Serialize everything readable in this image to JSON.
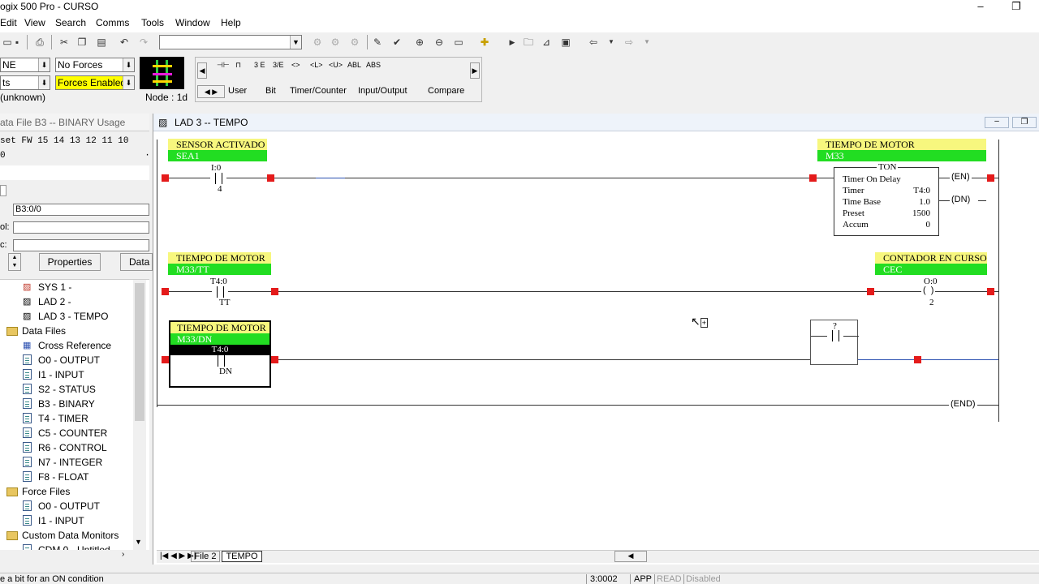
{
  "app": {
    "title": "ogix 500 Pro - CURSO"
  },
  "menu": [
    "Edit",
    "View",
    "Search",
    "Comms",
    "Tools",
    "Window",
    "Help"
  ],
  "toolbar": {
    "combo_value": ""
  },
  "status_panel": {
    "mode_value": "NE",
    "forces_value": "No Forces",
    "edits_value": "ts",
    "forces_enabled": "Forces Enabled",
    "unknown": "(unknown)",
    "node": "Node :  1d"
  },
  "instr_toolbar": {
    "icons": [
      "rung-icon",
      "branch-icon",
      "xic-icon",
      "xio-icon",
      "ote-icon",
      "otl-icon",
      "otu-icon",
      "abl-icon",
      "abs-icon"
    ],
    "icon_text": [
      "⊣⊢",
      "⊓",
      "3 E",
      "3/E",
      "<>",
      "<L>",
      "<U>",
      "ABL",
      "ABS"
    ],
    "tabs": [
      "User",
      "Bit",
      "Timer/Counter",
      "Input/Output",
      "Compare"
    ]
  },
  "data_file_pane": {
    "title": "ata File B3  --  BINARY Usage",
    "header": "set      FW 15 14 13 12 11 10",
    "row": "0                          ·    ·    ·    ·    ·    ·",
    "address_value": "B3:0/0",
    "symbol_label": "ol:",
    "desc_label": "c:",
    "properties_btn": "Properties",
    "data_btn": "Data"
  },
  "tree": [
    {
      "label": "SYS 1 -",
      "indent": 2,
      "icon": "ladder-red"
    },
    {
      "label": "LAD 2 -",
      "indent": 2,
      "icon": "ladder"
    },
    {
      "label": "LAD 3 - TEMPO",
      "indent": 2,
      "icon": "ladder"
    },
    {
      "label": "Data Files",
      "indent": 1,
      "icon": "folder"
    },
    {
      "label": "Cross Reference",
      "indent": 2,
      "icon": "xref"
    },
    {
      "label": "O0 - OUTPUT",
      "indent": 2,
      "icon": "file"
    },
    {
      "label": "I1 - INPUT",
      "indent": 2,
      "icon": "file"
    },
    {
      "label": "S2 - STATUS",
      "indent": 2,
      "icon": "file"
    },
    {
      "label": "B3 - BINARY",
      "indent": 2,
      "icon": "file"
    },
    {
      "label": "T4 - TIMER",
      "indent": 2,
      "icon": "file"
    },
    {
      "label": "C5 - COUNTER",
      "indent": 2,
      "icon": "file"
    },
    {
      "label": "R6 - CONTROL",
      "indent": 2,
      "icon": "file"
    },
    {
      "label": "N7 - INTEGER",
      "indent": 2,
      "icon": "file"
    },
    {
      "label": "F8 - FLOAT",
      "indent": 2,
      "icon": "file"
    },
    {
      "label": "Force Files",
      "indent": 1,
      "icon": "folder"
    },
    {
      "label": "O0 - OUTPUT",
      "indent": 2,
      "icon": "file"
    },
    {
      "label": "I1 - INPUT",
      "indent": 2,
      "icon": "file"
    },
    {
      "label": "Custom Data Monitors",
      "indent": 1,
      "icon": "folder"
    },
    {
      "label": "CDM 0 - Untitled",
      "indent": 2,
      "icon": "file"
    }
  ],
  "ladder": {
    "window_title": "LAD 3 -- TEMPO",
    "rung0": {
      "in_desc": "SENSOR ACTIVADO",
      "in_sym": "SEA1",
      "in_addr": "I:0",
      "in_bit": "4",
      "out_desc": "TIEMPO DE MOTOR",
      "out_sym": "M33",
      "ton_title": "TON",
      "ton_name": "Timer On Delay",
      "ton_rows": [
        [
          "Timer",
          "T4:0"
        ],
        [
          "Time Base",
          "1.0"
        ],
        [
          "Preset",
          "1500"
        ],
        [
          "Accum",
          "0"
        ]
      ],
      "en": "EN",
      "dn": "DN"
    },
    "rung1": {
      "in_desc": "TIEMPO DE MOTOR",
      "in_sym": "M33/TT",
      "in_addr": "T4:0",
      "in_bit": "TT",
      "out_desc": "CONTADOR EN CURSO",
      "out_sym": "CEC",
      "out_addr": "O:0",
      "out_bit": "2"
    },
    "rung2": {
      "in_desc": "TIEMPO DE MOTOR",
      "in_sym": "M33/DN",
      "in_addr": "T4:0",
      "in_bit": "DN",
      "placeholder": "?"
    },
    "end_label": "END",
    "tabs": [
      "File 2",
      "TEMPO"
    ]
  },
  "status_bar": {
    "hint": "e a bit for an ON condition",
    "pos": "3:0002",
    "app": "APP",
    "read": "READ",
    "disabled": "Disabled"
  }
}
